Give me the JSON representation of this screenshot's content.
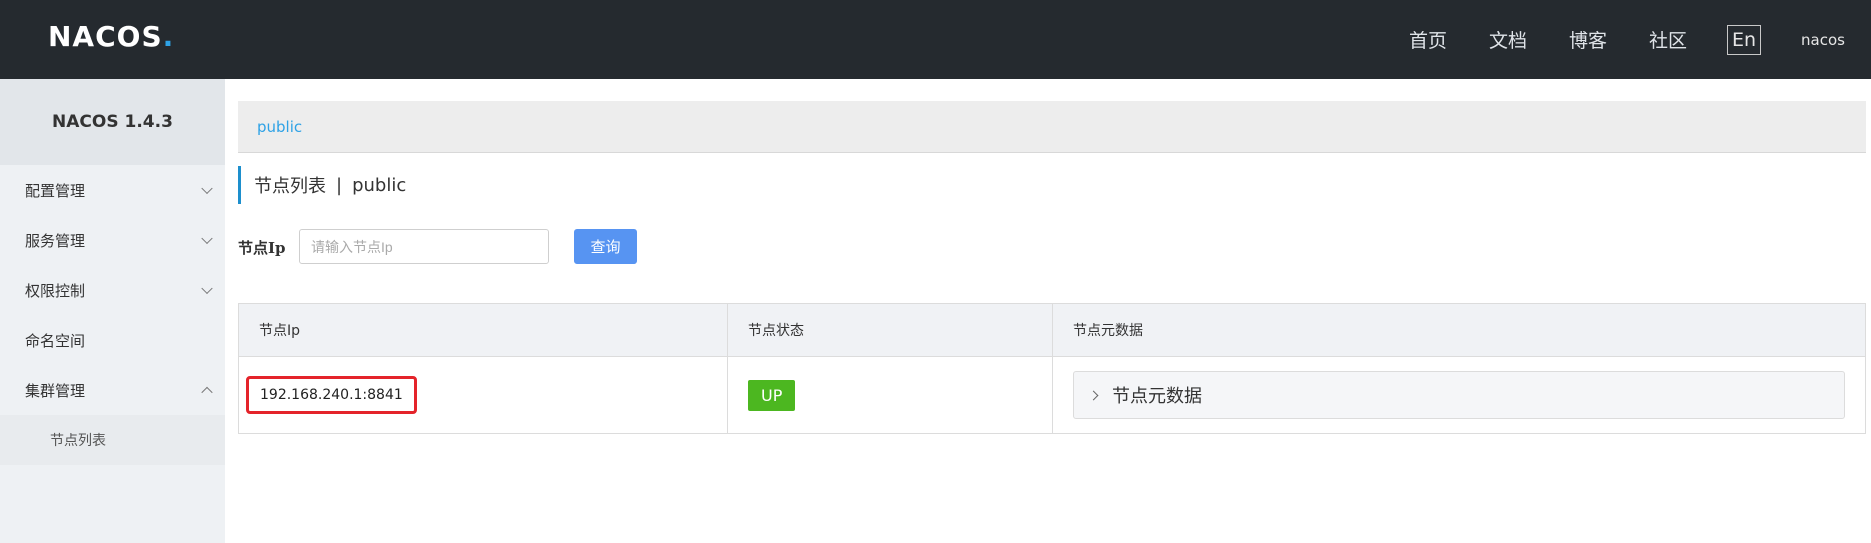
{
  "header": {
    "logo_text": "NACOS",
    "logo_dot": ".",
    "nav": [
      "首页",
      "文档",
      "博客",
      "社区"
    ],
    "lang": "En",
    "user": "nacos"
  },
  "sidebar": {
    "title": "NACOS 1.4.3",
    "items": [
      {
        "label": "配置管理",
        "expanded": false
      },
      {
        "label": "服务管理",
        "expanded": false
      },
      {
        "label": "权限控制",
        "expanded": false
      },
      {
        "label": "命名空间"
      },
      {
        "label": "集群管理",
        "expanded": true
      }
    ],
    "subitem": "节点列表"
  },
  "breadcrumb": "public",
  "page": {
    "title": "节点列表",
    "separator": "|",
    "namespace": "public"
  },
  "search": {
    "label": "节点Ip",
    "placeholder": "请输入节点Ip",
    "value": "",
    "button": "查询"
  },
  "table": {
    "headers": [
      "节点Ip",
      "节点状态",
      "节点元数据"
    ],
    "rows": [
      {
        "ip": "192.168.240.1:8841",
        "status": "UP",
        "metadata": "节点元数据"
      }
    ]
  },
  "colors": {
    "header_bg": "#252a2f",
    "accent": "#2ea2e6",
    "button": "#5794f2",
    "status_up": "#4cb720",
    "highlight": "#e4232a"
  }
}
